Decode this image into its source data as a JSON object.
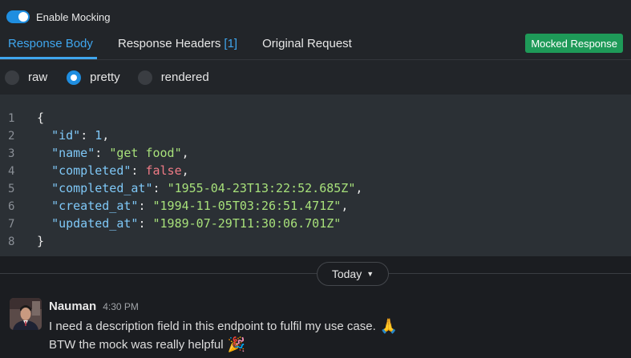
{
  "mocking": {
    "label": "Enable Mocking",
    "enabled": true
  },
  "tabs": [
    {
      "label": "Response Body",
      "active": true
    },
    {
      "label": "Response Headers",
      "count": "[1]"
    },
    {
      "label": "Original Request"
    }
  ],
  "badge": "Mocked Response",
  "view_modes": [
    {
      "label": "raw",
      "selected": false
    },
    {
      "label": "pretty",
      "selected": true
    },
    {
      "label": "rendered",
      "selected": false
    }
  ],
  "code": {
    "line_numbers": [
      "1",
      "2",
      "3",
      "4",
      "5",
      "6",
      "7",
      "8"
    ],
    "open_brace": "{",
    "close_brace": "}",
    "fields": [
      {
        "key": "\"id\"",
        "value": "1",
        "kind": "num",
        "comma": ","
      },
      {
        "key": "\"name\"",
        "value": "\"get food\"",
        "kind": "str",
        "comma": ","
      },
      {
        "key": "\"completed\"",
        "value": "false",
        "kind": "kw",
        "comma": ","
      },
      {
        "key": "\"completed_at\"",
        "value": "\"1955-04-23T13:22:52.685Z\"",
        "kind": "str",
        "comma": ","
      },
      {
        "key": "\"created_at\"",
        "value": "\"1994-11-05T03:26:51.471Z\"",
        "kind": "str",
        "comma": ","
      },
      {
        "key": "\"updated_at\"",
        "value": "\"1989-07-29T11:30:06.701Z\"",
        "kind": "str",
        "comma": ""
      }
    ]
  },
  "chat": {
    "day_label": "Today",
    "message": {
      "sender": "Nauman",
      "time": "4:30 PM",
      "line1": "I need a description field in this endpoint to fulfil my use case.",
      "line1_emoji": "🙏",
      "line2": "BTW the mock was really helpful",
      "line2_emoji": "🎉"
    }
  },
  "colors": {
    "accent": "#3fa6ee",
    "badge": "#1e9a58",
    "code_bg": "#2b3035",
    "string": "#a7e07a",
    "keyword": "#f07b86"
  }
}
